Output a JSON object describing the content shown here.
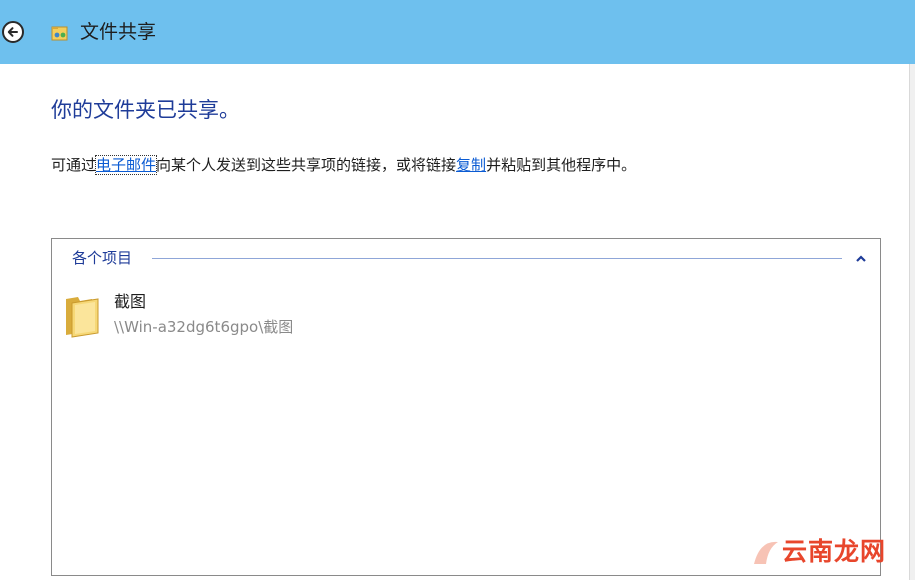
{
  "window": {
    "title": "文件共享"
  },
  "content": {
    "heading": "你的文件夹已共享。",
    "description": {
      "part1": "可通过",
      "email_link": "电子邮件",
      "part2": "向某个人发送到这些共享项的链接，或将链接",
      "copy_link": "复制",
      "part3": "并粘贴到其他程序中。"
    }
  },
  "items_group": {
    "title": "各个项目",
    "items": [
      {
        "name": "截图",
        "path": "\\\\Win-a32dg6t6gpo\\截图",
        "icon": "folder-icon"
      }
    ]
  },
  "watermark": {
    "text": "云南龙网"
  },
  "colors": {
    "titlebar": "#6ec0ee",
    "heading": "#1f3c99",
    "link": "#0b5bd3",
    "path_text": "#8a8a8a",
    "watermark": "#e8462c"
  }
}
